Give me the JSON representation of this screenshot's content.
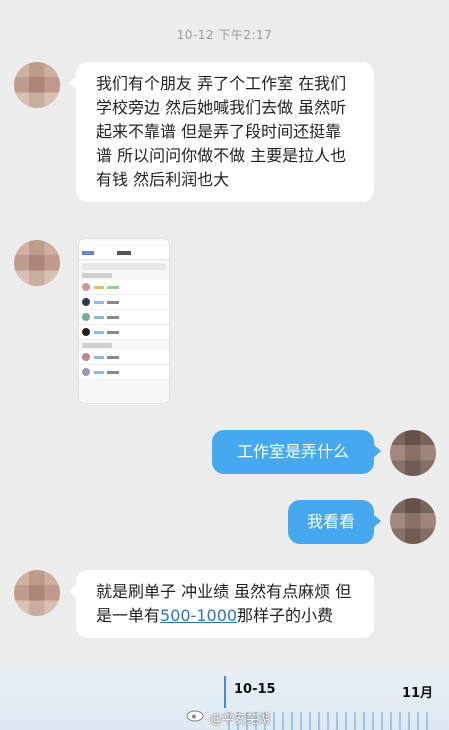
{
  "chat": {
    "timestamp": "10-12 下午2:17",
    "messages": [
      {
        "side": "left",
        "text": "我们有个朋友 弄了个工作室 在我们学校旁边 然后她喊我们去做 虽然听起来不靠谱 但是弄了段时间还挺靠谱 所以问问你做不做 主要是拉人也有钱 然后利润也大"
      },
      {
        "side": "left",
        "type": "image"
      },
      {
        "side": "right",
        "text": "工作室是弄什么"
      },
      {
        "side": "right",
        "text": "我看看"
      },
      {
        "side": "left",
        "text_before": "就是刷单子 冲业绩 虽然有点麻烦 但是一单有",
        "link": "500-1000",
        "text_after": "那样子的小费"
      }
    ]
  },
  "bottom_bar": {
    "date_left": "10-15",
    "date_right": "11月",
    "watermark": "@平安芜湖"
  },
  "colors": {
    "background": "#ececec",
    "bubble_left": "#ffffff",
    "bubble_right": "#46a8ef",
    "link": "#2b74c8"
  }
}
